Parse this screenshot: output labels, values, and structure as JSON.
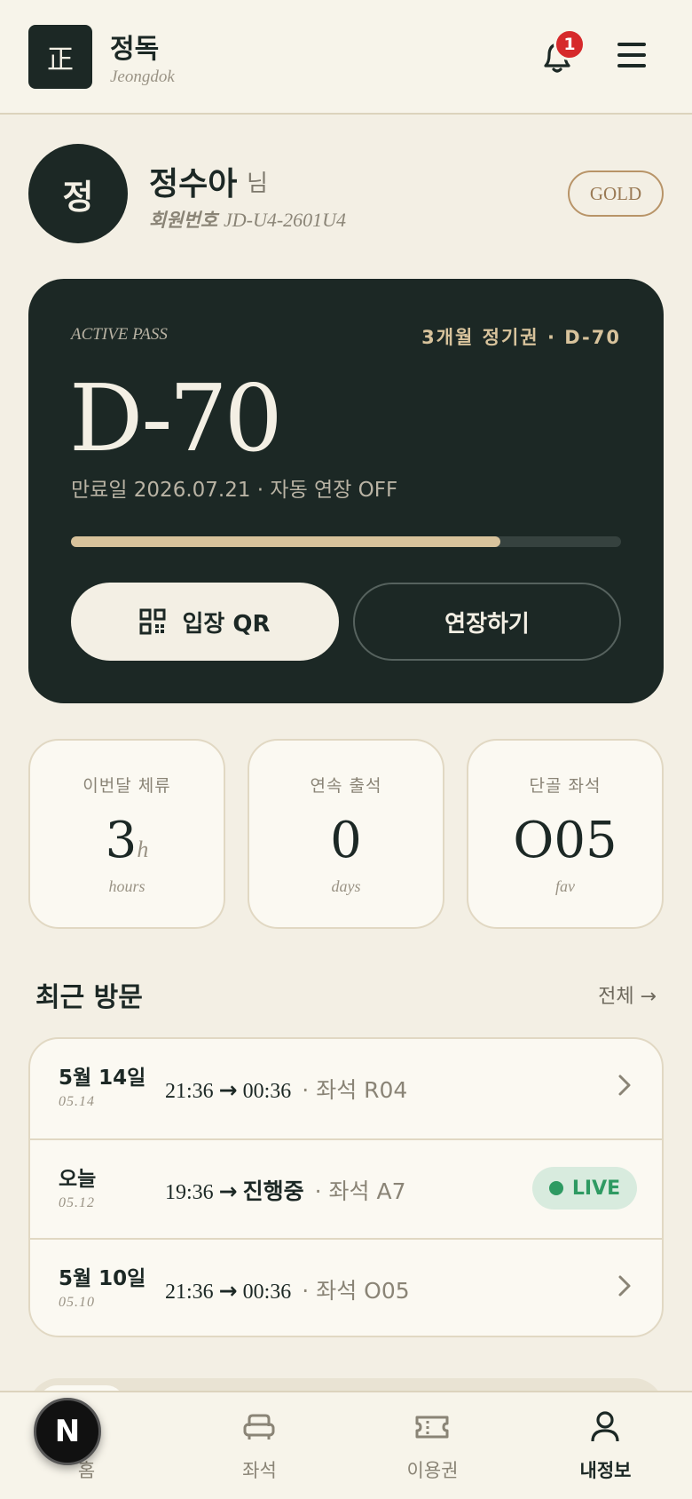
{
  "header": {
    "logo_glyph": "正",
    "brand_name": "정독",
    "brand_sub": "Jeongdok",
    "notification_count": "1"
  },
  "profile": {
    "avatar_initial": "정",
    "name": "정수아",
    "suffix": "님",
    "member_label": "회원번호",
    "member_id": "JD-U4-2601U4",
    "tier": "GOLD"
  },
  "pass": {
    "kicker": "ACTIVE PASS",
    "plan": "3개월 정기권 · D-70",
    "dday": "D-70",
    "expiry": "만료일 2026.07.21 · 자동 연장 OFF",
    "progress": 0.78,
    "qr_label": "입장 QR",
    "extend_label": "연장하기"
  },
  "stats": [
    {
      "label": "이번달 체류",
      "value": "3",
      "unit": "h",
      "sub": "hours"
    },
    {
      "label": "연속 출석",
      "value": "0",
      "unit": "",
      "sub": "days"
    },
    {
      "label": "단골 좌석",
      "value": "O05",
      "unit": "",
      "sub": "fav"
    }
  ],
  "recent": {
    "title": "최근 방문",
    "view_all": "전체 →",
    "visits": [
      {
        "date": "5월 14일",
        "date_sub": "05.14",
        "start": "21:36",
        "end": "00:36",
        "seat": "· 좌석 R04",
        "live": false
      },
      {
        "date": "오늘",
        "date_sub": "05.12",
        "start": "19:36",
        "end": "진행중",
        "seat": "· 좌석 A7",
        "live": true,
        "live_label": "LIVE"
      },
      {
        "date": "5월 10일",
        "date_sub": "05.10",
        "start": "21:36",
        "end": "00:36",
        "seat": "· 좌석 O05",
        "live": false
      }
    ]
  },
  "nav": {
    "items": [
      {
        "label": "홈",
        "icon": "home-icon"
      },
      {
        "label": "좌석",
        "icon": "seat-icon"
      },
      {
        "label": "이용권",
        "icon": "ticket-icon"
      },
      {
        "label": "내정보",
        "icon": "person-icon",
        "active": true
      }
    ],
    "fab_letter": "N"
  },
  "colors": {
    "background": "#f3efe4",
    "dark": "#1c2825",
    "accent_gold": "#d8c39c",
    "badge_red": "#d6292b",
    "live_green": "#2e9a62"
  }
}
